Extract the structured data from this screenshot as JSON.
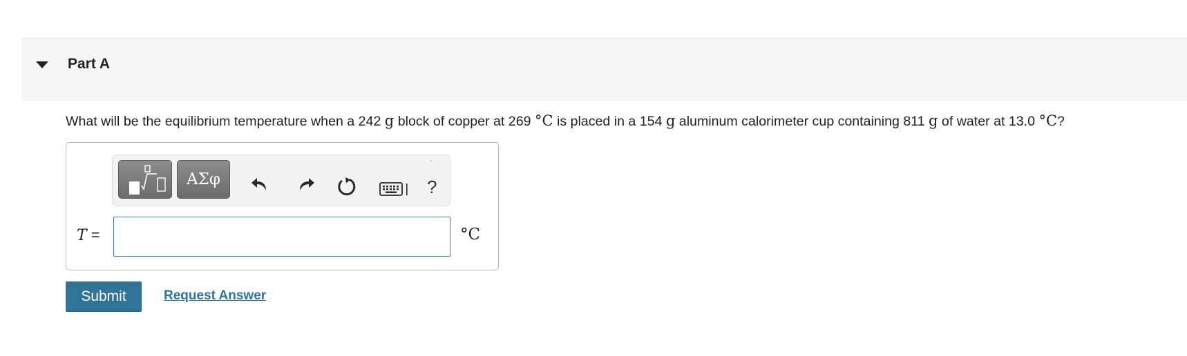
{
  "part": {
    "title": "Part A"
  },
  "question": {
    "text_1": "What will be the equilibrium temperature when a 242 ",
    "unit_g_1": "g",
    "text_2": " block of copper at 269 ",
    "unit_degC_1": "°C",
    "text_3": " is placed in a 154 ",
    "unit_g_2": "g",
    "text_4": " aluminum calorimeter cup containing 811 ",
    "unit_g_3": "g",
    "text_5": " of water at 13.0 ",
    "unit_degC_2": "°C",
    "text_6": "?"
  },
  "toolbar": {
    "greek_label": "ΑΣφ",
    "help_label": "?",
    "icons": [
      "templates-icon",
      "greek-symbols-icon",
      "undo-icon",
      "redo-icon",
      "reset-icon",
      "keyboard-icon",
      "help-icon"
    ]
  },
  "answer": {
    "variable": "T",
    "equals": " =",
    "value": "",
    "unit": "°C"
  },
  "actions": {
    "submit_label": "Submit",
    "request_answer_label": "Request Answer"
  },
  "colors": {
    "accent": "#2f7397",
    "input_border": "#3b7fa1",
    "header_bg": "#f6f6f6"
  }
}
